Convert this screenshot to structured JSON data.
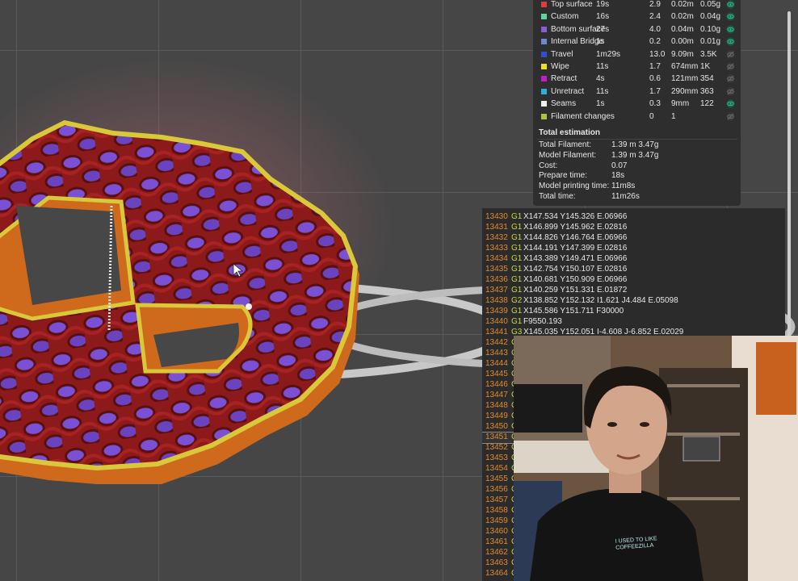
{
  "legend": {
    "items": [
      {
        "name": "Top surface",
        "time": "19s",
        "percent": "2.9",
        "length": "0.02m",
        "weight": "0.05g",
        "color": "#e03c3c",
        "visible": true
      },
      {
        "name": "Custom",
        "time": "16s",
        "percent": "2.4",
        "length": "0.02m",
        "weight": "0.04g",
        "color": "#5ed4a0",
        "visible": true
      },
      {
        "name": "Bottom surface",
        "time": "27s",
        "percent": "4.0",
        "length": "0.04m",
        "weight": "0.10g",
        "color": "#8a5cd6",
        "visible": true
      },
      {
        "name": "Internal Bridge",
        "time": "1s",
        "percent": "0.2",
        "length": "0.00m",
        "weight": "0.01g",
        "color": "#6a8ad0",
        "visible": true
      },
      {
        "name": "Travel",
        "time": "1m29s",
        "percent": "13.0",
        "length": "9.09m",
        "weight": "3.5K",
        "color": "#2f4fd0",
        "visible": false
      },
      {
        "name": "Wipe",
        "time": "11s",
        "percent": "1.7",
        "length": "674mm",
        "weight": "1K",
        "color": "#e8e030",
        "visible": false
      },
      {
        "name": "Retract",
        "time": "4s",
        "percent": "0.6",
        "length": "121mm",
        "weight": "354",
        "color": "#c020c0",
        "visible": false
      },
      {
        "name": "Unretract",
        "time": "11s",
        "percent": "1.7",
        "length": "290mm",
        "weight": "363",
        "color": "#30b0d8",
        "visible": false
      },
      {
        "name": "Seams",
        "time": "1s",
        "percent": "0.3",
        "length": "9mm",
        "weight": "122",
        "color": "#f0f0f0",
        "visible": true
      },
      {
        "name": "Filament changes",
        "time": "",
        "percent": "0",
        "length": "1",
        "weight": "",
        "color": "#b0c040",
        "visible": false
      }
    ],
    "total_title": "Total estimation",
    "totals": [
      {
        "label": "Total Filament:",
        "value": "1.39 m    3.47g"
      },
      {
        "label": "Model Filament:",
        "value": "1.39 m    3.47g"
      },
      {
        "label": "Cost:",
        "value": "0.07"
      },
      {
        "label": "Prepare time:",
        "value": "18s"
      },
      {
        "label": "Model printing time:",
        "value": "11m8s"
      },
      {
        "label": "Total time:",
        "value": "11m26s"
      }
    ]
  },
  "gcode": {
    "lines": [
      {
        "num": "13430",
        "cmd": "G1",
        "args": "X147.534 Y145.326 E.06966"
      },
      {
        "num": "13431",
        "cmd": "G1",
        "args": "X146.899 Y145.962 E.02816"
      },
      {
        "num": "13432",
        "cmd": "G1",
        "args": "X144.826 Y146.764 E.06966"
      },
      {
        "num": "13433",
        "cmd": "G1",
        "args": "X144.191 Y147.399 E.02816"
      },
      {
        "num": "13434",
        "cmd": "G1",
        "args": "X143.389 Y149.471 E.06966"
      },
      {
        "num": "13435",
        "cmd": "G1",
        "args": "X142.754 Y150.107 E.02816"
      },
      {
        "num": "13436",
        "cmd": "G1",
        "args": "X140.681 Y150.909 E.06966"
      },
      {
        "num": "13437",
        "cmd": "G1",
        "args": "X140.259 Y151.331 E.01872"
      },
      {
        "num": "13438",
        "cmd": "G2",
        "args": "X138.852 Y152.132 I1.621 J4.484 E.05098"
      },
      {
        "num": "13439",
        "cmd": "G1",
        "args": "X145.586 Y151.711 F30000"
      },
      {
        "num": "13440",
        "cmd": "G1",
        "args": "F9550.193"
      },
      {
        "num": "13441",
        "cmd": "G3",
        "args": "X145.035 Y152.051 I-4.608 J-6.852 E.02029"
      },
      {
        "num": "13442",
        "cmd": "G",
        "args": ""
      },
      {
        "num": "13443",
        "cmd": "G",
        "args": ""
      },
      {
        "num": "13444",
        "cmd": "G",
        "args": ""
      },
      {
        "num": "13445",
        "cmd": "G",
        "args": ""
      },
      {
        "num": "13446",
        "cmd": "G",
        "args": ""
      },
      {
        "num": "13447",
        "cmd": "G",
        "args": ""
      },
      {
        "num": "13448",
        "cmd": "G",
        "args": ""
      },
      {
        "num": "13449",
        "cmd": "G",
        "args": ""
      },
      {
        "num": "13450",
        "cmd": "G",
        "args": ""
      },
      {
        "num": "13451",
        "cmd": "G",
        "args": ""
      },
      {
        "num": "13452",
        "cmd": "G",
        "args": ""
      },
      {
        "num": "13453",
        "cmd": "G",
        "args": ""
      },
      {
        "num": "13454",
        "cmd": "G",
        "args": ""
      },
      {
        "num": "13455",
        "cmd": "G",
        "args": ""
      },
      {
        "num": "13456",
        "cmd": "G",
        "args": ""
      },
      {
        "num": "13457",
        "cmd": "G",
        "args": ""
      },
      {
        "num": "13458",
        "cmd": "G",
        "args": ""
      },
      {
        "num": "13459",
        "cmd": "G",
        "args": ""
      },
      {
        "num": "13460",
        "cmd": "G",
        "args": ""
      },
      {
        "num": "13461",
        "cmd": "G",
        "args": ""
      },
      {
        "num": "13462",
        "cmd": "G",
        "args": ""
      },
      {
        "num": "13463",
        "cmd": "G",
        "args": ""
      },
      {
        "num": "13464",
        "cmd": "G",
        "args": ""
      }
    ],
    "selected": "13451"
  },
  "webcam": {
    "shirt_line1": "I USED TO LIKE",
    "shirt_line2": "COFFEEZILLA"
  },
  "icons": {
    "visible": "eye-icon",
    "hidden": "eye-slash-icon"
  },
  "colors": {
    "panel": "#2e2e2e",
    "model_wall": "#d46a1e",
    "model_perimeter": "#d8c83a",
    "model_infill": "#8a1818",
    "model_solid": "#7a4cd0"
  }
}
